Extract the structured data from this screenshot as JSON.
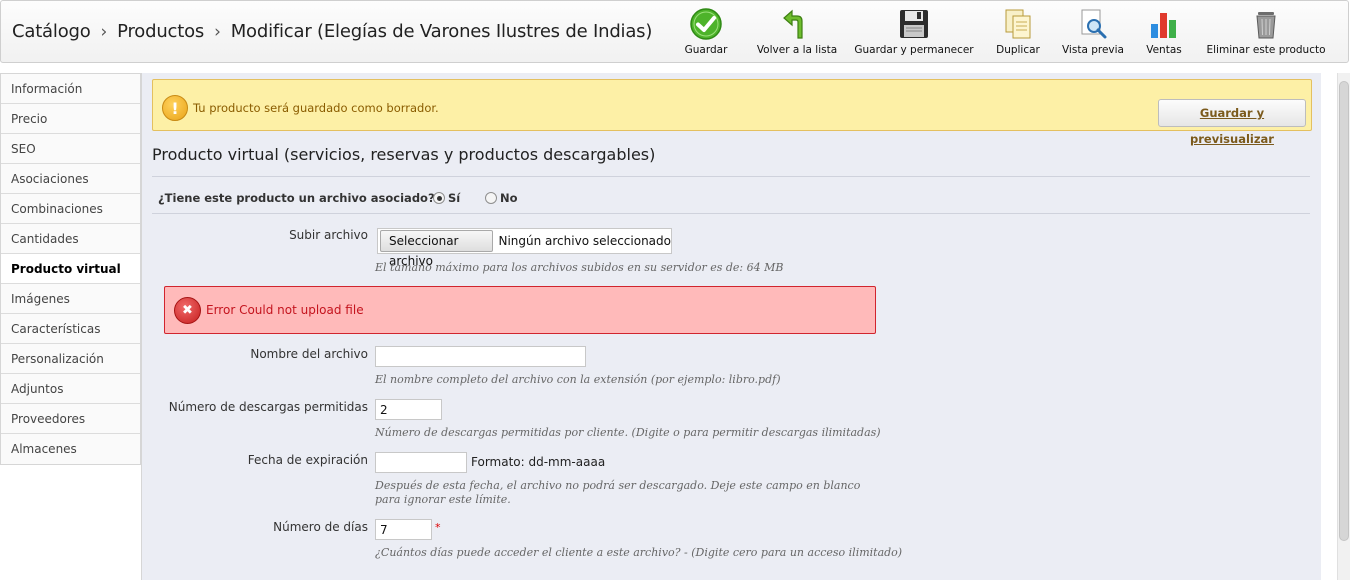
{
  "header": {
    "breadcrumb": [
      "Catálogo",
      "Productos",
      "Modificar (Elegías de Varones Ilustres de Indias)"
    ],
    "toolbar": {
      "save": "Guardar",
      "back": "Volver a la lista",
      "save_stay": "Guardar y permanecer",
      "duplicate": "Duplicar",
      "preview": "Vista previa",
      "sales": "Ventas",
      "delete": "Eliminar este producto"
    }
  },
  "sidebar": {
    "items": [
      {
        "label": "Información"
      },
      {
        "label": "Precio"
      },
      {
        "label": "SEO"
      },
      {
        "label": "Asociaciones"
      },
      {
        "label": "Combinaciones"
      },
      {
        "label": "Cantidades"
      },
      {
        "label": "Producto virtual",
        "active": true
      },
      {
        "label": "Imágenes"
      },
      {
        "label": "Características"
      },
      {
        "label": "Personalización"
      },
      {
        "label": "Adjuntos"
      },
      {
        "label": "Proveedores"
      },
      {
        "label": "Almacenes"
      }
    ]
  },
  "warning": {
    "text": "Tu producto será guardado como borrador.",
    "button": "Guardar y previsualizar"
  },
  "section": {
    "title": "Producto virtual (servicios, reservas y productos descargables)",
    "question": "¿Tiene este producto un archivo asociado?",
    "yes": "Sí",
    "no": "No",
    "selected": "yes"
  },
  "upload": {
    "label": "Subir archivo",
    "button": "Seleccionar archivo",
    "status": "Ningún archivo seleccionado",
    "hint": "El tamaño máximo para los archivos subidos en su servidor es de: 64 MB"
  },
  "error": {
    "text": "Error Could not upload file"
  },
  "filename": {
    "label": "Nombre del archivo",
    "value": "",
    "hint": "El nombre completo del archivo con la extensión (por ejemplo: libro.pdf)"
  },
  "downloads": {
    "label": "Número de descargas permitidas",
    "value": "2",
    "hint": "Número de descargas permitidas por cliente. (Digite o para permitir descargas ilimitadas)"
  },
  "expiration": {
    "label": "Fecha de expiración",
    "value": "",
    "format": "Formato: dd-mm-aaaa",
    "hint1": "Después de esta fecha, el archivo no podrá ser descargado. Deje este campo en blanco",
    "hint2": "para ignorar este límite."
  },
  "days": {
    "label": "Número de días",
    "value": "7",
    "required_mark": "*",
    "hint": "¿Cuántos días puede acceder el cliente a este archivo? - (Digite cero para un acceso ilimitado)"
  },
  "colors": {
    "warning_bg": "#fdf0a6",
    "error_bg": "#ffbaba",
    "main_bg": "#ebedf4"
  }
}
